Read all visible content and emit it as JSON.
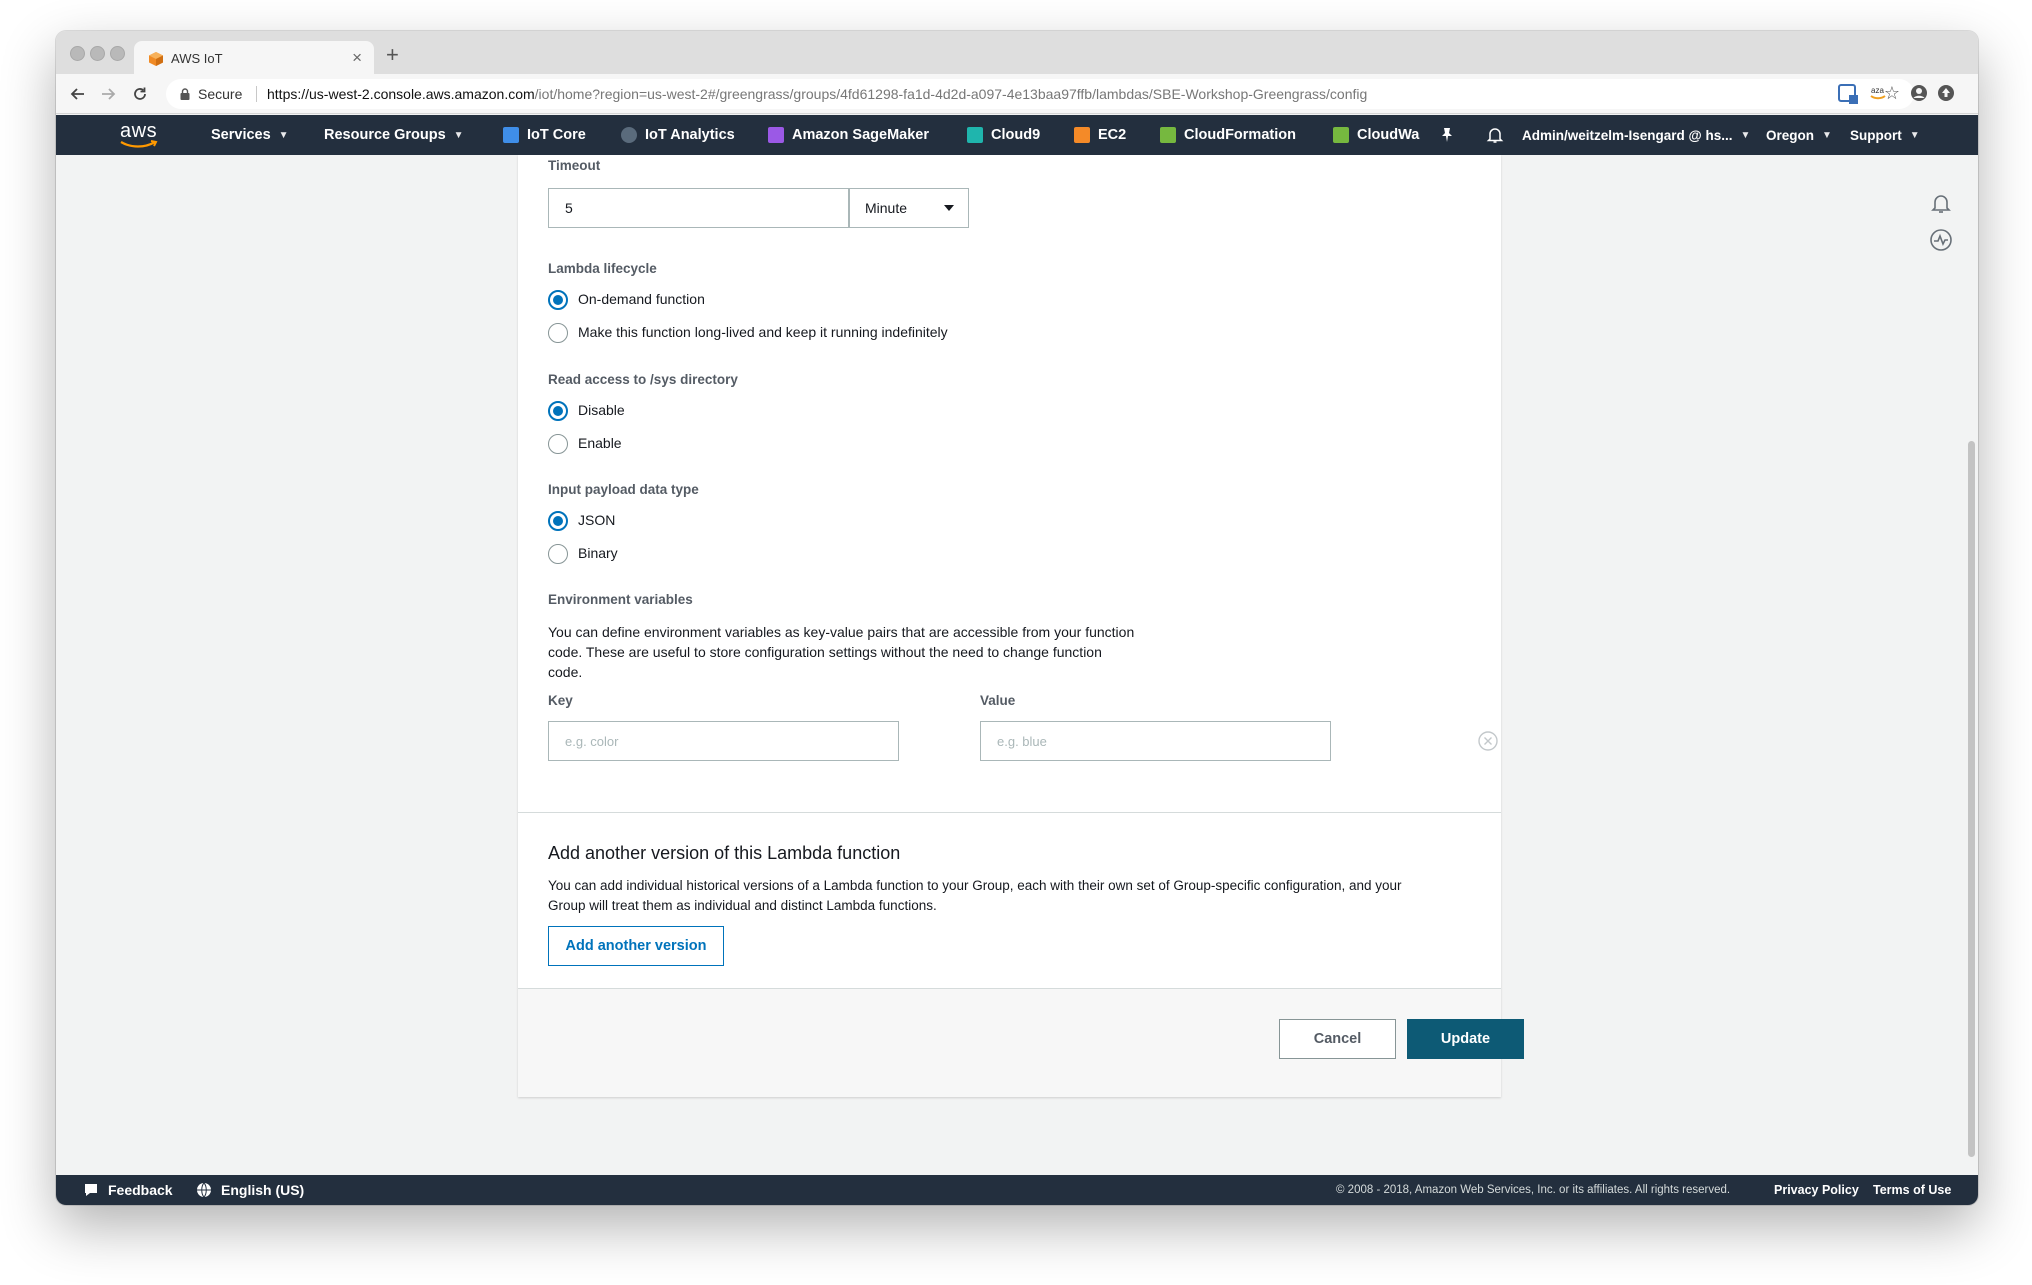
{
  "browser": {
    "tab_title": "AWS IoT",
    "tab_close": "×",
    "new_tab": "+",
    "secure_label": "Secure",
    "url_host": "https://us-west-2.console.aws.amazon.com",
    "url_path": "/iot/home?region=us-west-2#/greengrass/groups/4fd61298-fa1d-4d2d-a097-4e13baa97ffb/lambdas/SBE-Workshop-Greengrass/config",
    "bookmark_star": "☆"
  },
  "aws_nav": {
    "logo": "aws",
    "services": "Services",
    "resource_groups": "Resource Groups",
    "shortcuts": [
      {
        "label": "IoT Core",
        "icon": "iot-core-icon",
        "color": "#3f8ee8"
      },
      {
        "label": "IoT Analytics",
        "icon": "iot-analytics-icon",
        "color": "#5a6b7c"
      },
      {
        "label": "Amazon SageMaker",
        "icon": "sagemaker-icon",
        "color": "#9b59e6"
      },
      {
        "label": "Cloud9",
        "icon": "cloud9-icon",
        "color": "#1fb5ad"
      },
      {
        "label": "EC2",
        "icon": "ec2-icon",
        "color": "#f48a28"
      },
      {
        "label": "CloudFormation",
        "icon": "cloudformation-icon",
        "color": "#76b83f"
      },
      {
        "label": "CloudWa",
        "icon": "cloudwatch-icon",
        "color": "#76b83f"
      }
    ],
    "account": "Admin/weitzelm-Isengard @ hs...",
    "region": "Oregon",
    "support": "Support"
  },
  "form": {
    "timeout_label": "Timeout",
    "timeout_value": "5",
    "timeout_unit": "Minute",
    "lifecycle_label": "Lambda lifecycle",
    "lifecycle_options": [
      "On-demand function",
      "Make this function long-lived and keep it running indefinitely"
    ],
    "lifecycle_selected": 0,
    "sys_label": "Read access to /sys directory",
    "sys_options": [
      "Disable",
      "Enable"
    ],
    "sys_selected": 0,
    "payload_label": "Input payload data type",
    "payload_options": [
      "JSON",
      "Binary"
    ],
    "payload_selected": 0,
    "env_label": "Environment variables",
    "env_desc_lines": [
      "You can define environment variables as key-value pairs that are accessible from your function",
      "code. These are useful to store configuration settings without the need to change function",
      "code."
    ],
    "key_label": "Key",
    "key_placeholder": "e.g. color",
    "value_label": "Value",
    "value_placeholder": "e.g. blue"
  },
  "version_section": {
    "title": "Add another version of this Lambda function",
    "desc_lines": [
      "You can add individual historical versions of a Lambda function to your Group, each with their own set of Group-specific configuration, and your",
      "Group will treat them as individual and distinct Lambda functions."
    ],
    "button": "Add another version"
  },
  "actions": {
    "cancel": "Cancel",
    "update": "Update"
  },
  "footer": {
    "feedback": "Feedback",
    "language": "English (US)",
    "copyright": "© 2008 - 2018, Amazon Web Services, Inc. or its affiliates. All rights reserved.",
    "privacy": "Privacy Policy",
    "terms": "Terms of Use"
  },
  "colors": {
    "nav_bg": "#232f3e",
    "accent_blue": "#0073bb",
    "primary_button": "#0d5a75",
    "page_bg": "#f2f3f3"
  }
}
